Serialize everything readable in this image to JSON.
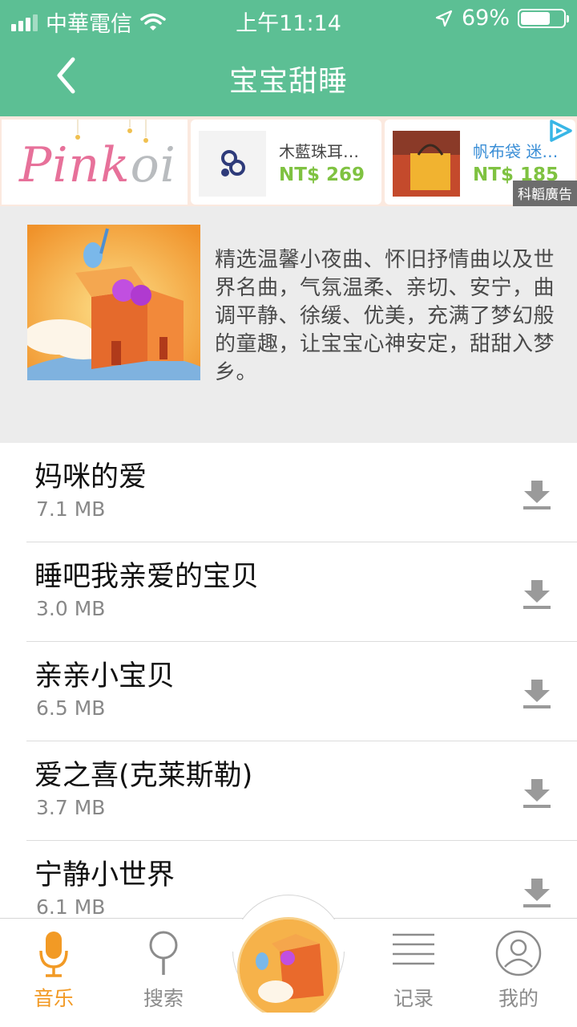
{
  "status": {
    "carrier": "中華電信",
    "time": "上午11:14",
    "battery": "69%",
    "battery_level": 0.69
  },
  "nav": {
    "title": "宝宝甜睡"
  },
  "ad": {
    "brand": "Pinkoi",
    "items": [
      {
        "name": "木藍珠耳…",
        "price": "NT$ 269"
      },
      {
        "name": "帆布袋 迷…",
        "price": "NT$ 185"
      }
    ],
    "tag": "科韜廣告"
  },
  "album": {
    "description": "精选温馨小夜曲、怀旧抒情曲以及世界名曲，气氛温柔、亲切、安宁，曲调平静、徐缓、优美，充满了梦幻般的童趣，让宝宝心神安定，甜甜入梦乡。"
  },
  "songs": [
    {
      "title": "妈咪的爱",
      "size": "7.1 MB"
    },
    {
      "title": "睡吧我亲爱的宝贝",
      "size": "3.0 MB"
    },
    {
      "title": "亲亲小宝贝",
      "size": "6.5 MB"
    },
    {
      "title": "爱之喜(克莱斯勒)",
      "size": "3.7 MB"
    },
    {
      "title": "宁静小世界",
      "size": "6.1 MB"
    }
  ],
  "tabs": {
    "music": "音乐",
    "search": "搜索",
    "history": "记录",
    "mine": "我的"
  },
  "colors": {
    "header": "#5cbf94",
    "accent": "#f29a25",
    "price": "#7fc241"
  }
}
